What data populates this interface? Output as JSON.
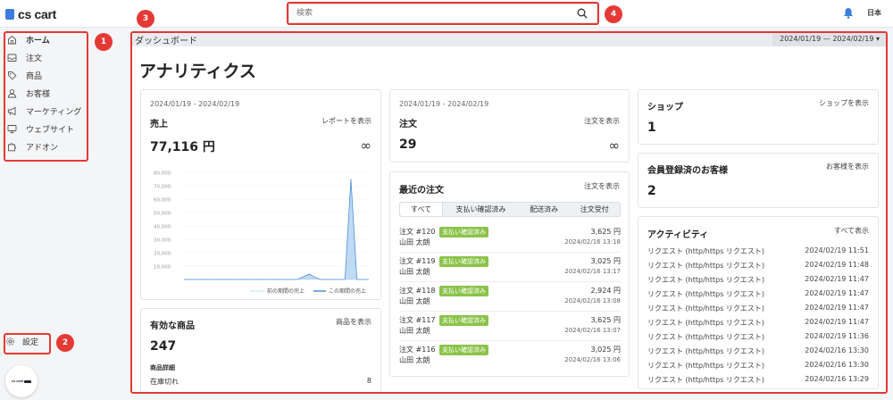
{
  "topbar": {
    "logo_text": "cs cart",
    "search_placeholder": "検索",
    "lang_label": "日本",
    "round_logo_text": "cs cart"
  },
  "sidebar": {
    "items": [
      {
        "label": "ホーム",
        "icon": "home-icon",
        "active": true
      },
      {
        "label": "注文",
        "icon": "inbox-icon"
      },
      {
        "label": "商品",
        "icon": "tag-icon"
      },
      {
        "label": "お客様",
        "icon": "user-icon"
      },
      {
        "label": "マーケティング",
        "icon": "megaphone-icon"
      },
      {
        "label": "ウェブサイト",
        "icon": "monitor-icon"
      },
      {
        "label": "アドオン",
        "icon": "puzzle-icon"
      }
    ],
    "settings_label": "設定"
  },
  "annotations": [
    "1",
    "2",
    "3",
    "4"
  ],
  "header": {
    "title": "ダッシュボード",
    "date_range": "2024/01/19 — 2024/02/19 ▾"
  },
  "main": {
    "page_title": "アナリティクス",
    "sales": {
      "date": "2024/01/19 - 2024/02/19",
      "title": "売上",
      "link": "レポートを表示",
      "value": "77,116 円",
      "infinity": "∞",
      "legend_prev": "前の期間の売上",
      "legend_curr": "この期間の売上"
    },
    "products": {
      "title": "有効な商品",
      "link": "商品を表示",
      "value": "247",
      "detail_label": "商品詳細",
      "out_of_stock_label": "在庫切れ",
      "out_of_stock_value": "8"
    },
    "orders": {
      "date": "2024/01/19 - 2024/02/19",
      "title": "注文",
      "link": "注文を表示",
      "value": "29",
      "infinity": "∞"
    },
    "recent_orders": {
      "title": "最近の注文",
      "link": "注文を表示",
      "tabs": [
        "すべて",
        "支払い確認済み",
        "配送済み",
        "注文受付"
      ],
      "rows": [
        {
          "no": "注文 #120",
          "status": "支払い確認済み",
          "amount": "3,625 円",
          "customer": "山田 太朗",
          "time": "2024/02/16 13:18"
        },
        {
          "no": "注文 #119",
          "status": "支払い確認済み",
          "amount": "3,025 円",
          "customer": "山田 太朗",
          "time": "2024/02/16 13:17"
        },
        {
          "no": "注文 #118",
          "status": "支払い確認済み",
          "amount": "2,924 円",
          "customer": "山田 太朗",
          "time": "2024/02/16 13:08"
        },
        {
          "no": "注文 #117",
          "status": "支払い確認済み",
          "amount": "3,625 円",
          "customer": "山田 太朗",
          "time": "2024/02/16 13:07"
        },
        {
          "no": "注文 #116",
          "status": "支払い確認済み",
          "amount": "3,025 円",
          "customer": "山田 太朗",
          "time": "2024/02/16 13:06"
        }
      ]
    },
    "shops": {
      "title": "ショップ",
      "link": "ショップを表示",
      "value": "1"
    },
    "customers": {
      "title": "会員登録済のお客様",
      "link": "お客様を表示",
      "value": "2"
    },
    "activity": {
      "title": "アクティビティ",
      "link": "すべて表示",
      "rows": [
        {
          "label": "リクエスト (http/https リクエスト)",
          "time": "2024/02/19 11:51"
        },
        {
          "label": "リクエスト (http/https リクエスト)",
          "time": "2024/02/19 11:48"
        },
        {
          "label": "リクエスト (http/https リクエスト)",
          "time": "2024/02/19 11:47"
        },
        {
          "label": "リクエスト (http/https リクエスト)",
          "time": "2024/02/19 11:47"
        },
        {
          "label": "リクエスト (http/https リクエスト)",
          "time": "2024/02/19 11:47"
        },
        {
          "label": "リクエスト (http/https リクエスト)",
          "time": "2024/02/19 11:47"
        },
        {
          "label": "リクエスト (http/https リクエスト)",
          "time": "2024/02/19 11:36"
        },
        {
          "label": "リクエスト (http/https リクエスト)",
          "time": "2024/02/16 13:30"
        },
        {
          "label": "リクエスト (http/https リクエスト)",
          "time": "2024/02/16 13:30"
        },
        {
          "label": "リクエスト (http/https リクエスト)",
          "time": "2024/02/16 13:29"
        }
      ]
    }
  },
  "colors": {
    "accent": "#3b7ddd",
    "annotation": "#e53935",
    "badge": "#8bc34a",
    "chart_line": "#4a90d9",
    "chart_fill": "#a9cdef"
  },
  "chart_data": {
    "type": "area",
    "title": "",
    "ylim": [
      0,
      80000
    ],
    "y_ticks": [
      "80,000",
      "70,000",
      "60,000",
      "50,000",
      "40,000",
      "30,000",
      "20,000",
      "10,000",
      "0"
    ],
    "x": [
      0,
      1,
      2,
      3,
      4,
      5,
      6,
      7,
      8,
      9,
      10,
      11,
      12,
      13,
      14,
      15,
      16,
      17,
      18,
      19,
      20,
      21,
      22,
      23,
      24,
      25,
      26,
      27,
      28,
      29,
      30,
      31
    ],
    "series": [
      {
        "name": "前の期間の売上",
        "values": [
          0,
          0,
          0,
          0,
          0,
          0,
          0,
          0,
          0,
          0,
          0,
          0,
          0,
          0,
          0,
          0,
          0,
          0,
          0,
          0,
          0,
          0,
          0,
          0,
          0,
          0,
          0,
          0,
          0,
          0,
          0,
          0
        ]
      },
      {
        "name": "この期間の売上",
        "values": [
          0,
          0,
          0,
          0,
          0,
          0,
          0,
          0,
          0,
          0,
          0,
          0,
          0,
          0,
          0,
          0,
          0,
          0,
          0,
          0,
          2000,
          4000,
          1500,
          0,
          0,
          0,
          0,
          0,
          75000,
          0,
          0,
          0
        ]
      }
    ]
  }
}
